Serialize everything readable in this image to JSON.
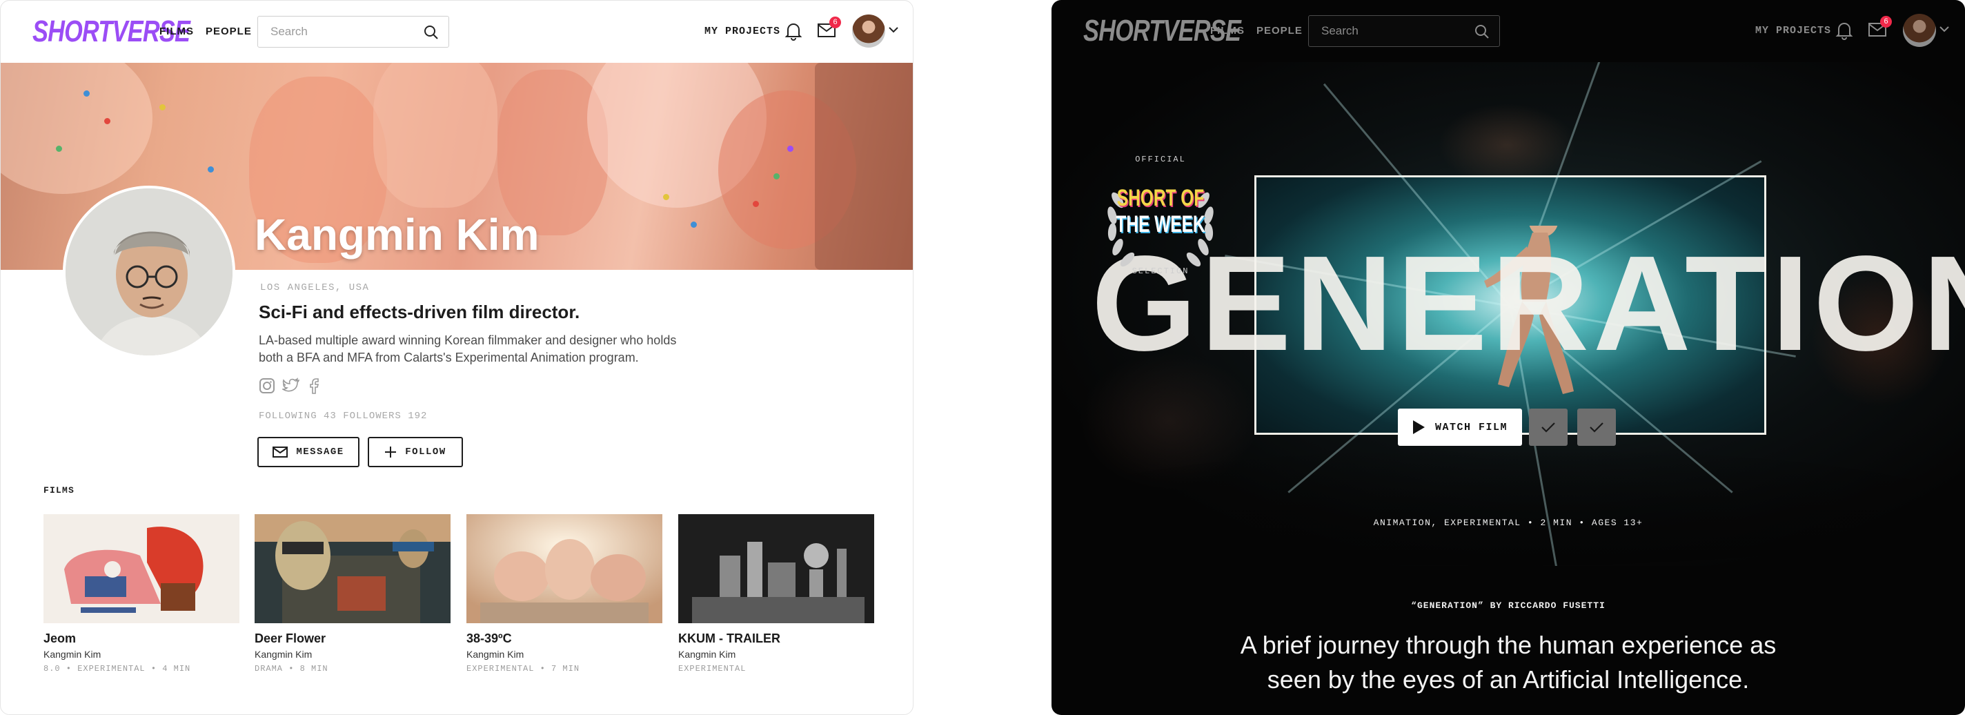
{
  "left_screen": {
    "nav": {
      "logo": "SHORTVERSE",
      "links": [
        "FILMS",
        "PEOPLE"
      ],
      "search_placeholder": "Search",
      "my_projects": "MY PROJECTS",
      "mail_badge": "6"
    },
    "profile": {
      "name": "Kangmin Kim",
      "location": "LOS ANGELES, USA",
      "tagline": "Sci-Fi and effects-driven film director.",
      "bio": "LA-based multiple award winning Korean filmmaker and designer who holds both a BFA and MFA from Calarts's Experimental Animation program.",
      "stats": "FOLLOWING 43  FOLLOWERS 192",
      "message_label": "MESSAGE",
      "follow_label": "FOLLOW",
      "social_icons": [
        "instagram-icon",
        "twitter-icon",
        "facebook-icon"
      ]
    },
    "films_heading": "FILMS",
    "films": [
      {
        "title": "Jeom",
        "by": "Kangmin Kim",
        "meta": "8.0 • EXPERIMENTAL • 4 MIN"
      },
      {
        "title": "Deer Flower",
        "by": "Kangmin Kim",
        "meta": "DRAMA • 8 MIN"
      },
      {
        "title": "38-39ºC",
        "by": "Kangmin Kim",
        "meta": "EXPERIMENTAL • 7 MIN"
      },
      {
        "title": "KKUM - TRAILER",
        "by": "Kangmin Kim",
        "meta": "EXPERIMENTAL"
      }
    ]
  },
  "right_screen": {
    "nav": {
      "logo": "SHORTVERSE",
      "links": [
        "FILMS",
        "PEOPLE"
      ],
      "search_placeholder": "Search",
      "my_projects": "MY PROJECTS",
      "mail_badge": "6"
    },
    "badge": {
      "top": "OFFICIAL",
      "line1": "SHORT OF",
      "line2": "THE WEEK",
      "bottom": "SELECTION"
    },
    "hero_title": "GENERATION",
    "watch_label": "WATCH FILM",
    "genres": "ANIMATION, EXPERIMENTAL • 2 MIN • AGES 13+",
    "credit": "“GENERATION” BY RICCARDO FUSETTI",
    "description": "A brief journey through the human experience as seen by the eyes of an Artificial Intelligence."
  },
  "colors": {
    "brand_purple": "#9b4df5",
    "badge_red": "#f0294a",
    "dark_bg": "#050505"
  }
}
